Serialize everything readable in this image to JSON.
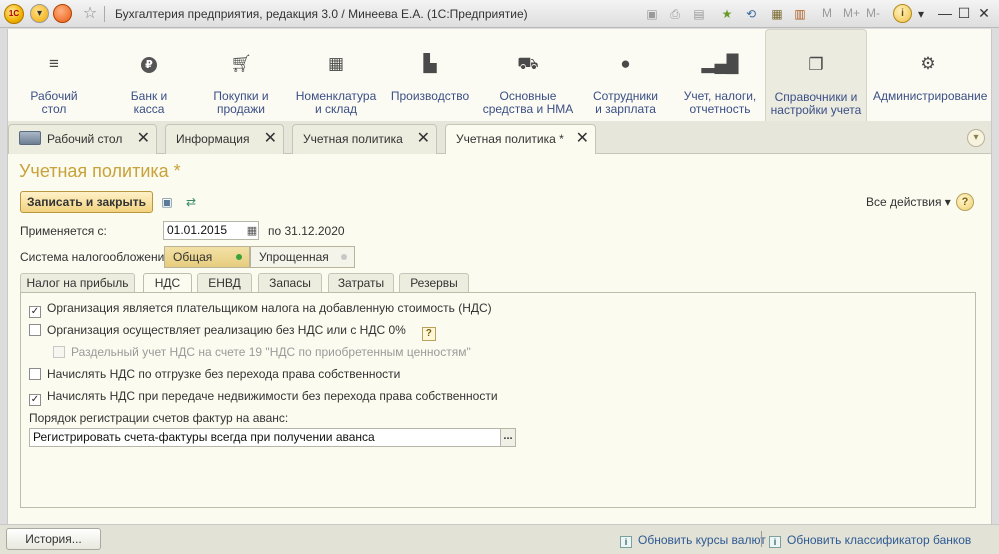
{
  "titlebar": {
    "logo_text": "1С",
    "title": "Бухгалтерия предприятия, редакция 3.0 / Минеева Е.А.  (1С:Предприятие)",
    "m_label": "M",
    "mplus_label": "M+",
    "mminus_label": "M-"
  },
  "sections": [
    {
      "label": "Рабочий\nстол",
      "icon": "menu-icon"
    },
    {
      "label": "Банк и\nкасса",
      "icon": "ruble-coin-icon"
    },
    {
      "label": "Покупки и\nпродажи",
      "icon": "cart-icon"
    },
    {
      "label": "Номенклатура\nи склад",
      "icon": "grid-icon"
    },
    {
      "label": "Производство",
      "icon": "factory-icon"
    },
    {
      "label": "Основные\nсредства и НМА",
      "icon": "truck-icon"
    },
    {
      "label": "Сотрудники\nи зарплата",
      "icon": "person-icon"
    },
    {
      "label": "Учет, налоги,\nотчетность",
      "icon": "bar-chart-icon"
    },
    {
      "label": "Справочники и\nнастройки учета",
      "icon": "documents-icon"
    },
    {
      "label": "Администрирование",
      "icon": "gear-icon"
    }
  ],
  "window_tabs": [
    {
      "label": "Рабочий стол"
    },
    {
      "label": "Информация"
    },
    {
      "label": "Учетная политика"
    },
    {
      "label": "Учетная политика *"
    }
  ],
  "form": {
    "title": "Учетная политика *",
    "save_close_label": "Записать и закрыть",
    "all_actions_label": "Все действия ▾",
    "help_label": "?",
    "applies_from_label": "Применяется с:",
    "applies_from_value": "01.01.2015",
    "applies_to_text": "по 31.12.2020",
    "tax_system_label": "Система налогообложения:",
    "tax_options": [
      {
        "label": "Общая",
        "selected": true
      },
      {
        "label": "Упрощенная",
        "selected": false
      }
    ],
    "inner_tabs": [
      "Налог на прибыль",
      "НДС",
      "ЕНВД",
      "Запасы",
      "Затраты",
      "Резервы"
    ],
    "active_inner_tab": "НДС",
    "checkboxes": [
      {
        "label": "Организация является плательщиком налога на добавленную стоимость (НДС)",
        "checked": true,
        "disabled": false
      },
      {
        "label": "Организация осуществляет реализацию без НДС или с НДС 0%",
        "checked": false,
        "disabled": false
      },
      {
        "label": "Раздельный учет НДС на счете 19 \"НДС по приобретенным ценностям\"",
        "checked": false,
        "disabled": true
      },
      {
        "label": "Начислять НДС по отгрузке без перехода права собственности",
        "checked": false,
        "disabled": false
      },
      {
        "label": "Начислять НДС при передаче недвижимости без перехода права собственности",
        "checked": true,
        "disabled": false
      }
    ],
    "invoice_order_label": "Порядок регистрации счетов фактур на аванс:",
    "invoice_order_value": "Регистрировать счета-фактуры всегда при получении аванса",
    "dots_label": "..."
  },
  "statusbar": {
    "history_label": "История...",
    "link1": "Обновить курсы валют",
    "link2": "Обновить классификатор банков"
  },
  "colors": {
    "form_title": "#c8a23a",
    "accent_button": "#f1d27f",
    "section_text": "#3b4f86",
    "radio_green": "#3aa23a"
  }
}
